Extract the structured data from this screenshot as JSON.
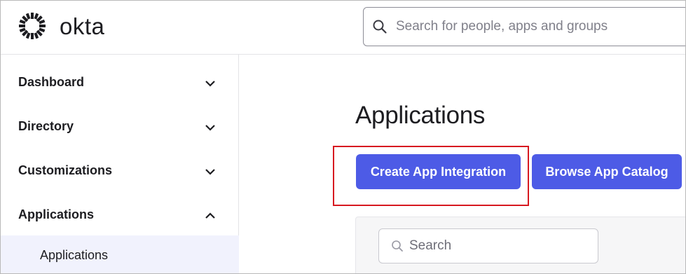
{
  "header": {
    "logo_text": "okta",
    "search": {
      "placeholder": "Search for people, apps and groups",
      "value": ""
    }
  },
  "sidebar": {
    "items": [
      {
        "label": "Dashboard",
        "expanded": false
      },
      {
        "label": "Directory",
        "expanded": false
      },
      {
        "label": "Customizations",
        "expanded": false
      },
      {
        "label": "Applications",
        "expanded": true
      }
    ],
    "sub_items": [
      {
        "label": "Applications",
        "selected": true
      }
    ]
  },
  "main": {
    "title": "Applications",
    "buttons": {
      "create": "Create App Integration",
      "browse": "Browse App Catalog"
    },
    "search": {
      "placeholder": "Search",
      "value": ""
    }
  },
  "colors": {
    "primary_button": "#4d5be6",
    "highlight_border": "#d71920",
    "selected_nav_bg": "#f1f2fd"
  },
  "icons": {
    "logo": "okta-sunburst-icon",
    "search": "search-icon",
    "chevron_down": "chevron-down-icon",
    "chevron_up": "chevron-up-icon"
  }
}
